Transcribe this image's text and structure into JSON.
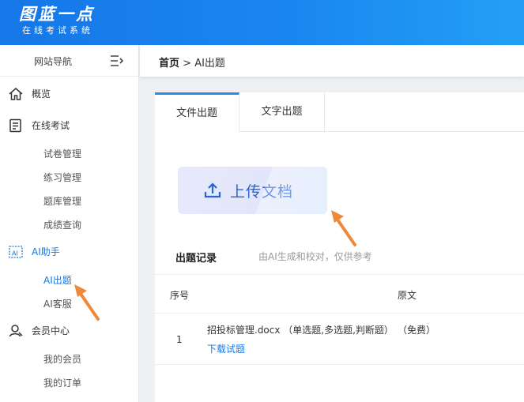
{
  "brand": {
    "title": "图蓝一点",
    "subtitle": "在线考试系统"
  },
  "sidebar": {
    "header": "网站导航",
    "items": [
      {
        "label": "概览",
        "icon": "home-icon"
      },
      {
        "label": "在线考试",
        "icon": "exam-icon",
        "children": [
          "试卷管理",
          "练习管理",
          "题库管理",
          "成绩查询"
        ]
      },
      {
        "label": "AI助手",
        "icon": "ai-icon",
        "children": [
          "AI出题",
          "AI客服"
        ]
      },
      {
        "label": "会员中心",
        "icon": "user-icon",
        "children": [
          "我的会员",
          "我的订单"
        ]
      }
    ],
    "active": "AI出题"
  },
  "breadcrumb": {
    "home": "首页",
    "separator": ">",
    "current": "AI出题"
  },
  "tabs": [
    "文件出题",
    "文字出题"
  ],
  "upload": {
    "label": "上传文档"
  },
  "records": {
    "title": "出题记录",
    "note": "由AI生成和校对，仅供参考"
  },
  "table": {
    "headers": [
      "序号",
      "原文"
    ],
    "rows": [
      {
        "no": "1",
        "name": "招投标管理.docx （单选题,多选题,判断题）",
        "download": "下载试题",
        "price": "（免费）"
      }
    ]
  },
  "colors": {
    "brand": "#1677e8",
    "accent": "#2b8be8",
    "annotation": "#f0883a"
  }
}
